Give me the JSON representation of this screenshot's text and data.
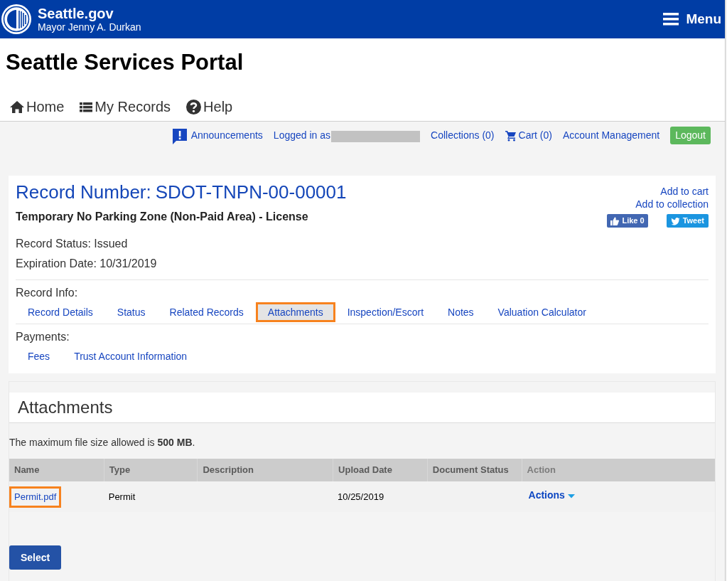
{
  "header": {
    "site_name": "Seattle.gov",
    "tagline": "Mayor Jenny A. Durkan",
    "menu_label": "Menu"
  },
  "portal_title": "Seattle Services Portal",
  "main_nav": [
    {
      "label": "Home"
    },
    {
      "label": "My Records"
    },
    {
      "label": "Help"
    }
  ],
  "account_bar": {
    "links": [
      {
        "label": "Announcements",
        "kind": "announcements"
      },
      {
        "label": "Logged in as",
        "kind": "user",
        "redacted": true
      },
      {
        "label": "Collections (0)",
        "kind": "link"
      },
      {
        "label": "Cart (0)",
        "kind": "cart"
      },
      {
        "label": "Account Management",
        "kind": "link"
      }
    ],
    "logout": "Logout"
  },
  "record": {
    "heading_label": "Record Number:",
    "number": "SDOT-TNPN-00-00001",
    "type": "Temporary No Parking Zone (Non-Paid Area) - License",
    "links": [
      "Add to cart",
      "Add to collection"
    ],
    "social": [
      {
        "label": "Like 0",
        "kind": "like"
      },
      {
        "label": "Tweet",
        "kind": "tweet"
      }
    ],
    "fields": [
      "Record Status: Issued",
      "Expiration Date: 10/31/2019"
    ],
    "sections": [
      {
        "title": "Record Info:",
        "tabs": [
          {
            "label": "Record Details",
            "selected": false,
            "highlighted": false
          },
          {
            "label": "Status",
            "selected": false,
            "highlighted": false
          },
          {
            "label": "Related Records",
            "selected": false,
            "highlighted": false
          },
          {
            "label": "Attachments",
            "selected": true,
            "highlighted": true
          },
          {
            "label": "Inspection/Escort",
            "selected": false,
            "highlighted": false
          },
          {
            "label": "Notes",
            "selected": false,
            "highlighted": false
          },
          {
            "label": "Valuation Calculator",
            "selected": false,
            "highlighted": false
          }
        ]
      },
      {
        "title": "Payments:",
        "tabs": [
          {
            "label": "Fees",
            "selected": false,
            "highlighted": false
          },
          {
            "label": "Trust Account Information",
            "selected": false,
            "highlighted": false
          }
        ]
      }
    ]
  },
  "attachments": {
    "title": "Attachments",
    "note": "The maximum file size allowed is **500 MB**.",
    "columns": [
      {
        "label": "Name",
        "kind": "sortable"
      },
      {
        "label": "Type",
        "kind": "sortable"
      },
      {
        "label": "Description",
        "kind": "sortable"
      },
      {
        "label": "Upload Date",
        "kind": "sortable"
      },
      {
        "label": "Document Status",
        "kind": "sortable"
      },
      {
        "label": "Action",
        "kind": "plain"
      }
    ],
    "rows": [
      {
        "name": "Permit.pdf",
        "name_highlighted": true,
        "type": "Permit",
        "upload_date": "10/25/2019",
        "action": "Actions"
      }
    ],
    "button": "Select"
  }
}
